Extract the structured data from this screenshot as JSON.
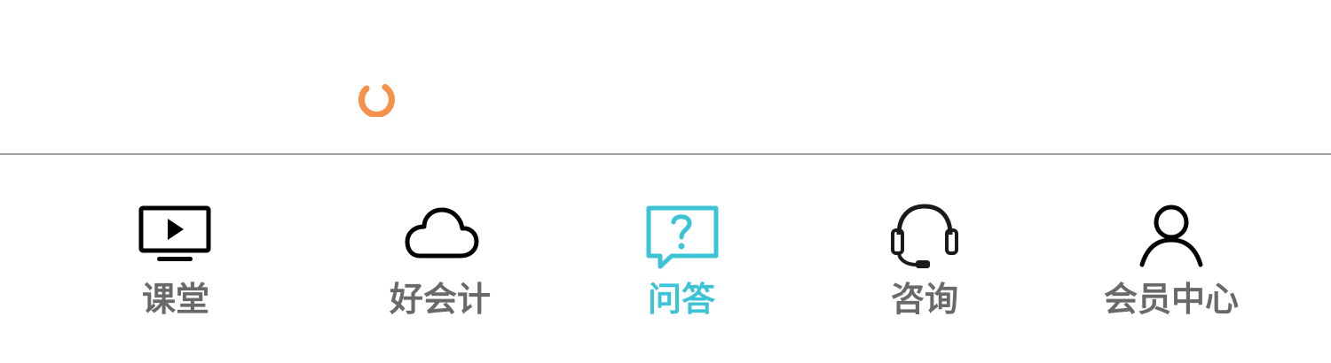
{
  "colors": {
    "accent": "#3dc3d6",
    "spinner": "#f5914a",
    "inactive_label": "#696969",
    "icon_dark": "#1a1a1a",
    "divider": "#a3a3a3"
  },
  "loading": {
    "icon": "loading-spinner-icon"
  },
  "tabs": [
    {
      "label": "课堂",
      "icon": "tv-play-icon",
      "active": false
    },
    {
      "label": "好会计",
      "icon": "cloud-icon",
      "active": false
    },
    {
      "label": "问答",
      "icon": "question-bubble-icon",
      "active": true
    },
    {
      "label": "咨询",
      "icon": "headset-icon",
      "active": false
    },
    {
      "label": "会员中心",
      "icon": "user-icon",
      "active": false
    }
  ]
}
